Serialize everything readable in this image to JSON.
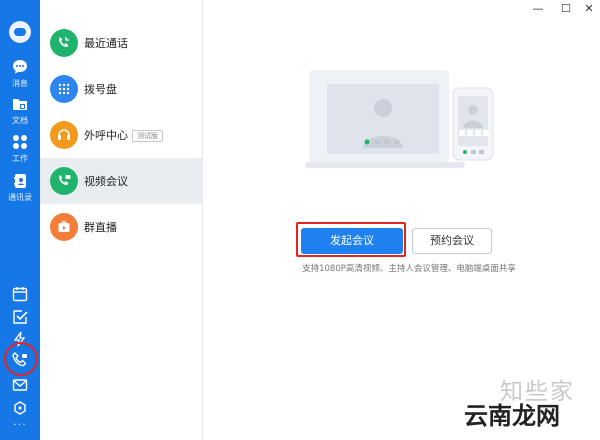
{
  "rail": {
    "items": [
      {
        "label": "消息",
        "icon": "chat-bubble-icon"
      },
      {
        "label": "文档",
        "icon": "document-folder-icon"
      },
      {
        "label": "工作",
        "icon": "grid-apps-icon"
      },
      {
        "label": "通讯录",
        "icon": "contacts-book-icon"
      }
    ],
    "bottom_icons": [
      "calendar-icon",
      "checkbox-task-icon",
      "lightning-icon",
      "phone-call-icon",
      "mail-icon",
      "puzzle-plugin-icon"
    ],
    "more": "···"
  },
  "list": {
    "items": [
      {
        "label": "最近通话",
        "color": "#20b36b",
        "icon": "recent-call-icon"
      },
      {
        "label": "拨号盘",
        "color": "#2d86f0",
        "icon": "dialpad-icon"
      },
      {
        "label": "外呼中心",
        "color": "#f39a1e",
        "icon": "headset-icon",
        "badge": "测试版"
      },
      {
        "label": "视频会议",
        "color": "#20b36b",
        "icon": "video-meeting-icon"
      },
      {
        "label": "群直播",
        "color": "#f47d3a",
        "icon": "live-broadcast-icon"
      }
    ],
    "active_index": 3
  },
  "window": {
    "minimize": "—",
    "maximize": "☐",
    "close": "✕"
  },
  "main": {
    "start_meeting": "发起会议",
    "schedule_meeting": "预约会议",
    "hint": "支持1080P高清视频、主持人会议管理、电脑端桌面共享"
  },
  "watermark": {
    "line1": "知些家",
    "line2": "云南龙网"
  },
  "colors": {
    "rail": "#1677e6",
    "primary": "#1f80f0",
    "highlight": "#e8231d"
  }
}
